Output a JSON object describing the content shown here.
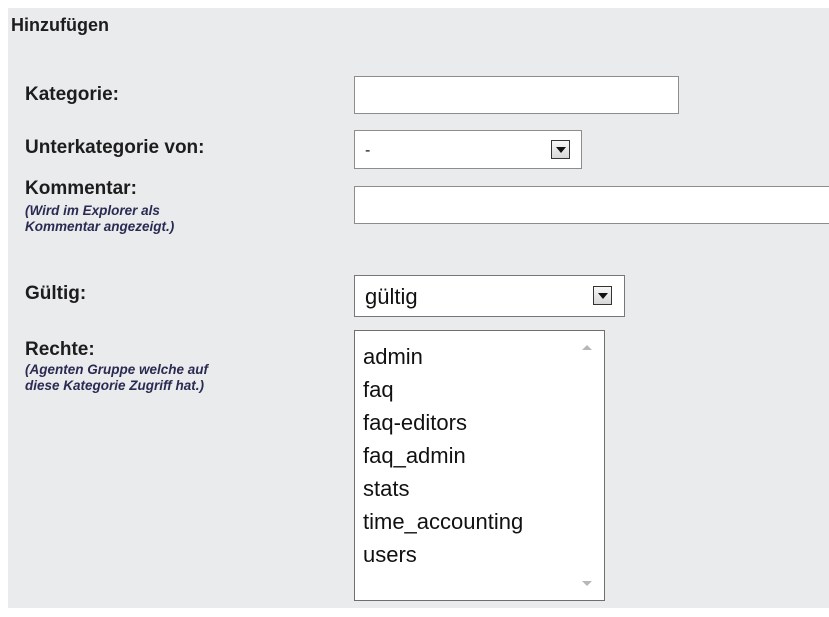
{
  "section": {
    "title": "Hinzufügen"
  },
  "fields": {
    "category": {
      "label": "Kategorie:",
      "value": ""
    },
    "subcategory": {
      "label": "Unterkategorie von:",
      "selected": "-"
    },
    "comment": {
      "label": "Kommentar:",
      "hint_line1": "(Wird im Explorer als",
      "hint_line2": "Kommentar angezeigt.)",
      "value": ""
    },
    "valid": {
      "label": "Gültig:",
      "selected": "gültig"
    },
    "rights": {
      "label": "Rechte:",
      "hint_line1": "(Agenten Gruppe welche auf",
      "hint_line2": "diese Kategorie Zugriff hat.)",
      "options": [
        "admin",
        "faq",
        "faq-editors",
        "faq_admin",
        "stats",
        "time_accounting",
        "users"
      ]
    }
  },
  "icons": {
    "dropdown": "chevron-down-icon",
    "scroll_up": "scroll-up-arrow-icon",
    "scroll_down": "scroll-down-arrow-icon"
  }
}
